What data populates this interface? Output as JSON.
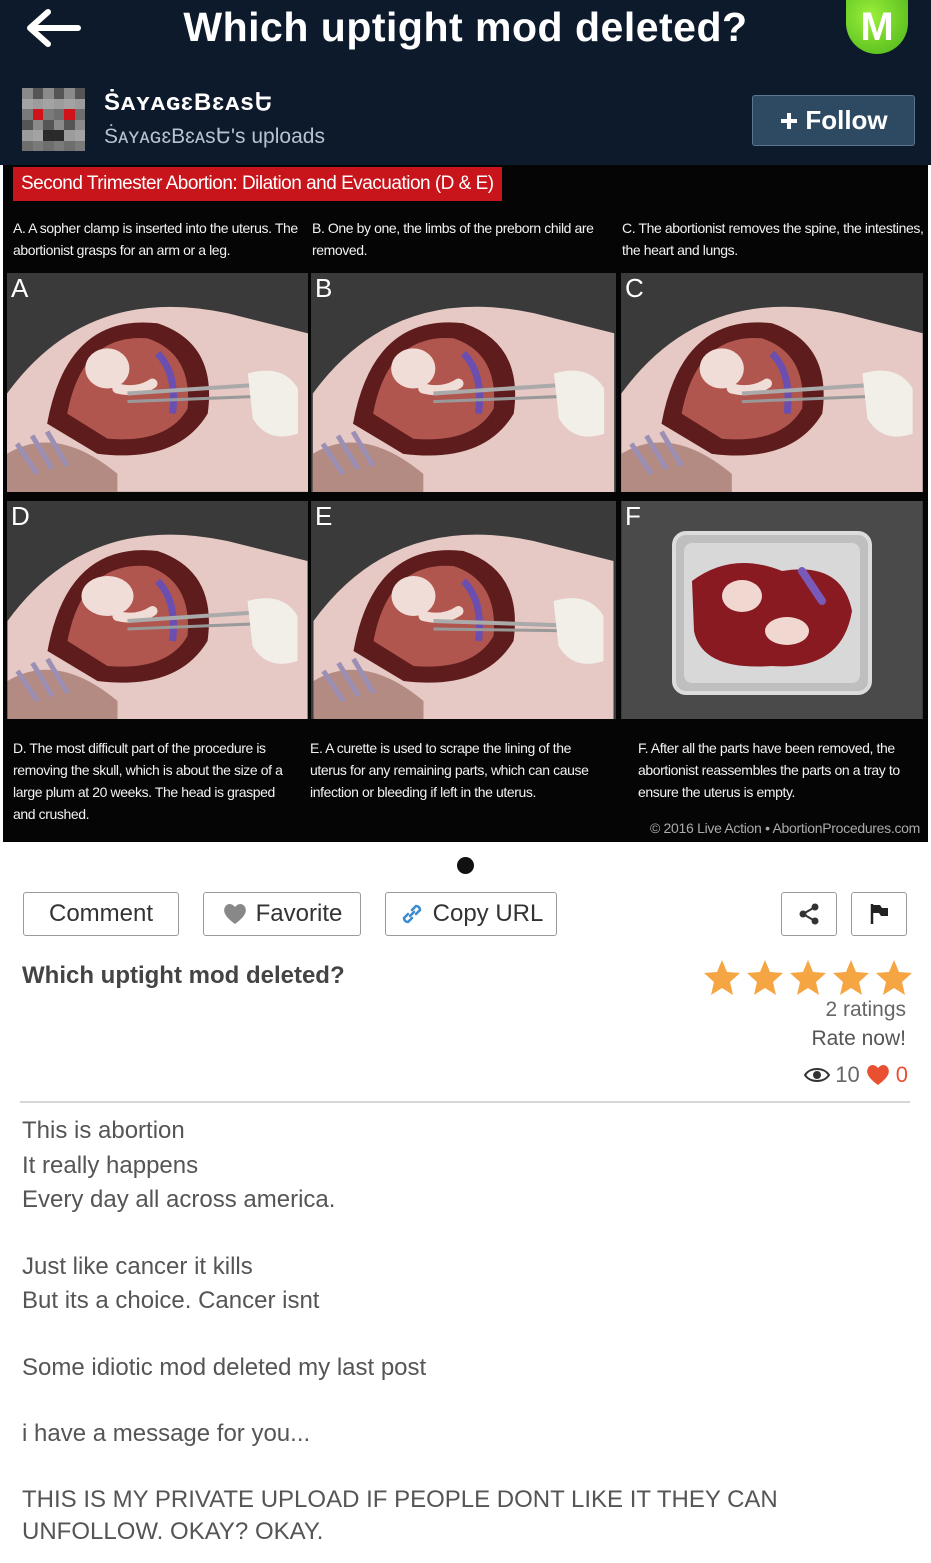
{
  "topbar": {
    "title": "Which uptight mod deleted?",
    "back_icon": "arrow-left-icon",
    "logo_letter": "M",
    "logo_color": "#5ccc1f"
  },
  "uploader": {
    "name": "ṠᴀʏᴀɢɛBɛᴀsԵ",
    "uploads_label": "ṠᴀʏᴀɢɛBɛᴀsԵ's uploads",
    "follow_label": "Follow"
  },
  "figure": {
    "title": "Second Trimester Abortion: Dilation and Evacuation (D & E)",
    "captions_top": [
      "A. A sopher clamp is inserted into the uterus. The abortionist grasps for an arm or a leg.",
      "B. One by one, the limbs of the preborn child are removed.",
      "C. The abortionist removes the spine, the intestines, the heart and lungs."
    ],
    "panel_letters": [
      "A",
      "B",
      "C",
      "D",
      "E",
      "F"
    ],
    "captions_bottom": [
      "D. The most difficult part of the procedure is removing the skull, which is about the size of a large plum at 20 weeks. The head is grasped and crushed.",
      "E. A curette is used to scrape the lining of the uterus for any remaining parts, which can cause infection or bleeding if left in the uterus.",
      "F. After all the parts have been removed, the abortionist reassembles the parts on a tray to ensure the uterus is empty."
    ],
    "credit": "© 2016 Live Action • AbortionProcedures.com"
  },
  "actions": {
    "comment_label": "Comment",
    "favorite_label": "Favorite",
    "copy_url_label": "Copy URL",
    "share_icon": "share-icon",
    "flag_icon": "flag-icon"
  },
  "post": {
    "title": "Which uptight mod deleted?",
    "rating_stars": 5,
    "ratings_text": "2 ratings",
    "rate_now": "Rate now!",
    "views": "10",
    "likes": "0",
    "star_color": "#f5a542",
    "heart_color": "#e8502f",
    "body": [
      "This is abortion",
      "It really happens",
      "Every day all across america.",
      "",
      "Just like cancer it kills",
      "But its a choice. Cancer isnt",
      "",
      "Some idiotic mod deleted my last post",
      "",
      "i have a message for you...",
      "",
      "THIS IS MY PRIVATE UPLOAD IF PEOPLE DONT LIKE IT THEY CAN UNFOLLOW. OKAY? OKAY."
    ]
  }
}
